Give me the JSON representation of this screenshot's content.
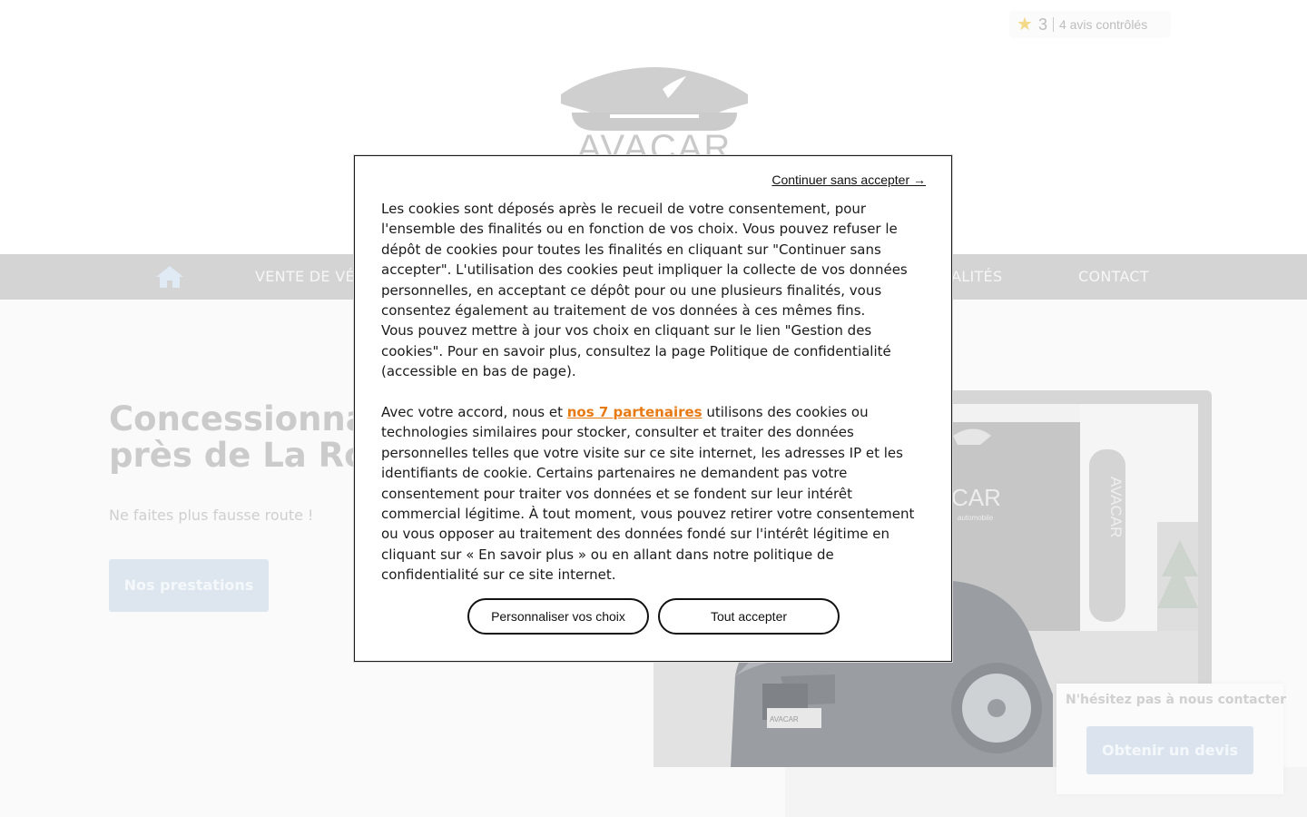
{
  "rating": {
    "score": "3",
    "reviews": "4 avis contrôlés"
  },
  "logo": {
    "text": "AVACAR"
  },
  "nav": {
    "home_icon": "home-icon",
    "items": [
      "VENTE DE VÉ",
      "ALITÉS",
      "CONTACT"
    ]
  },
  "hero": {
    "title_line1": "Concessionna",
    "title_line2": "près de La Ro",
    "subtitle": "Ne faites plus fausse route !",
    "cta": "Nos prestations"
  },
  "photo": {
    "sign_text": "CAR",
    "sign_sub": "automobile",
    "banner_text": "AVACAR",
    "plate_text": "AVACAR"
  },
  "contact_widget": {
    "title": "N'hésitez pas à nous contacter",
    "button": "Obtenir un devis"
  },
  "cookie_modal": {
    "skip_label": "Continuer sans accepter →",
    "paragraph1": "Les cookies sont déposés après le recueil de votre consentement, pour l'ensemble des finalités ou en fonction de vos choix. Vous pouvez refuser le dépôt de cookies pour toutes les finalités en cliquant sur \"Continuer sans accepter\". L'utilisation des cookies peut impliquer la collecte de vos données personnelles, en acceptant ce dépôt pour ou une plusieurs finalités, vous consentez également au traitement de vos données à ces mêmes fins.",
    "paragraph2": "Vous pouvez mettre à jour vos choix en cliquant sur le lien \"Gestion des cookies\". Pour en savoir plus, consultez la page Politique de confidentialité (accessible en bas de page).",
    "paragraph3_before": "Avec votre accord, nous et ",
    "partners_link": "nos 7 partenaires",
    "paragraph3_after": " utilisons des cookies ou technologies similaires pour stocker, consulter et traiter des données personnelles telles que votre visite sur ce site internet, les adresses IP et les identifiants de cookie. Certains partenaires ne demandent pas votre consentement pour traiter vos données et se fondent sur leur intérêt commercial légitime. À tout moment, vous pouvez retirer votre consentement ou vous opposer au traitement des données fondé sur l'intérêt légitime en cliquant sur « En savoir plus » ou en allant dans notre politique de confidentialité sur ce site internet.",
    "customize_button": "Personnaliser vos choix",
    "accept_button": "Tout accepter"
  },
  "colors": {
    "accent_link": "#e87a14",
    "nav_bg": "#d4d4d4",
    "cta_bg": "#dde6ee",
    "modal_border": "#1b1b1b"
  }
}
